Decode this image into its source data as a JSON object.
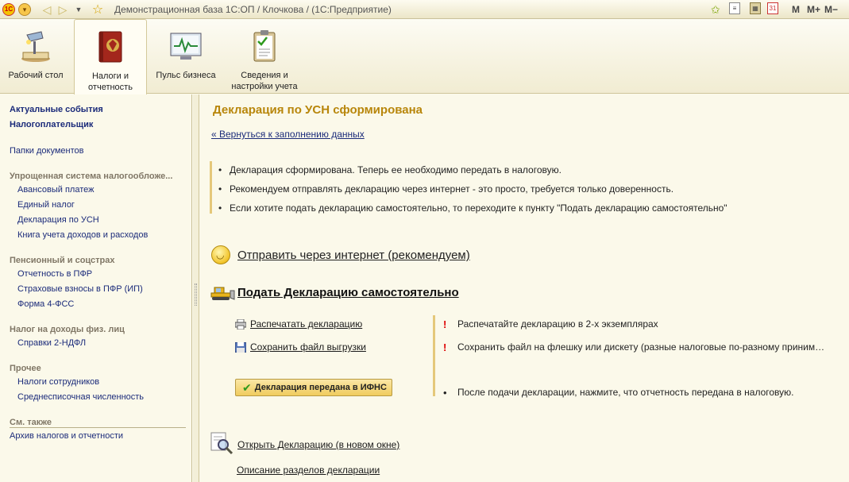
{
  "titlebar": {
    "window_title": "Демонстрационная база 1С:ОП / Клочкова / (1С:Предприятие)",
    "logo_text": "1С",
    "m_label": "M",
    "m_plus_label": "M+",
    "m_minus_label": "M−",
    "calendar_day": "31"
  },
  "sections": [
    {
      "label": "Рабочий стол"
    },
    {
      "label": "Налоги и отчетность"
    },
    {
      "label": "Пульс бизнеса"
    },
    {
      "label": "Сведения и настройки учета"
    }
  ],
  "leftnav": {
    "top_items": [
      "Актуальные события",
      "Налогоплательщик"
    ],
    "folders": "Папки документов",
    "usn_group": "Упрощенная система налогообложе...",
    "usn_items": [
      "Авансовый платеж",
      "Единый налог",
      "Декларация по УСН",
      "Книга учета доходов и расходов"
    ],
    "pension_group": "Пенсионный и соцстрах",
    "pension_items": [
      "Отчетность в ПФР",
      "Страховые взносы в ПФР (ИП)",
      "Форма 4-ФСС"
    ],
    "ndfl_group": "Налог на доходы физ. лиц",
    "ndfl_items": [
      "Справки  2-НДФЛ"
    ],
    "other_group": "Прочее",
    "other_items": [
      "Налоги сотрудников",
      "Среднесписочная численность"
    ],
    "see_also_group": "См. также",
    "see_also_items": [
      "Архив налогов и отчетности"
    ]
  },
  "main": {
    "title": "Декларация по УСН сформирована",
    "back_link": "« Вернуться к заполнению данных",
    "info": [
      "Декларация сформирована. Теперь ее необходимо передать в налоговую.",
      "Рекомендуем отправлять декларацию через интернет - это просто, требуется только доверенность.",
      "Если хотите подать декларацию самостоятельно, то переходите к пункту \"Подать декларацию самостоятельно\""
    ],
    "send_internet": "Отправить через интернет (рекомендуем)",
    "self_submit": "Подать Декларацию самостоятельно",
    "print_link": "Распечатать декларацию",
    "save_link": "Сохранить файл выгрузки",
    "ifns_button": "Декларация передана в ИФНС",
    "warnings": [
      "Распечатайте декларацию в 2-х экземплярах",
      "Сохранить файл на флешку или дискету (разные налоговые по-разному приним…"
    ],
    "after_note": "После подачи декларации, нажмите, что отчетность передана в налоговую.",
    "open_link": "Открыть Декларацию (в новом окне)",
    "desc_link": "Описание разделов декларации"
  },
  "colors": {
    "background": "#fbf9ea",
    "title": "#b8860b",
    "link": "#1b2b7a",
    "warning": "#d00000",
    "accent_border": "#e5c87a"
  }
}
